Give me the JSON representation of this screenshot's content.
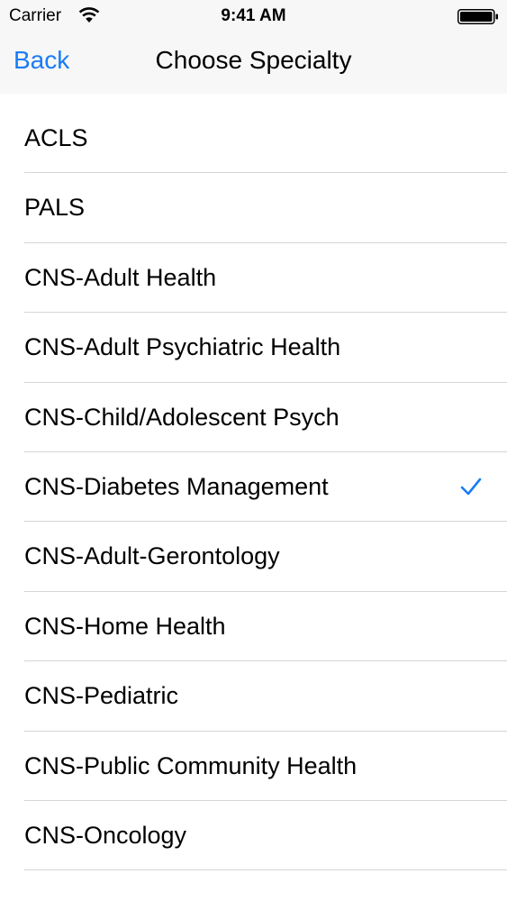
{
  "status_bar": {
    "carrier": "Carrier",
    "time": "9:41 AM",
    "icons": [
      "wifi-icon",
      "battery-icon"
    ]
  },
  "nav": {
    "back_label": "Back",
    "title": "Choose Specialty"
  },
  "accent_color": "#1a7cf5",
  "specialties": [
    {
      "label": "ACLS",
      "selected": false
    },
    {
      "label": "PALS",
      "selected": false
    },
    {
      "label": "CNS-Adult Health",
      "selected": false
    },
    {
      "label": "CNS-Adult Psychiatric Health",
      "selected": false
    },
    {
      "label": "CNS-Child/Adolescent Psych",
      "selected": false
    },
    {
      "label": "CNS-Diabetes Management",
      "selected": true
    },
    {
      "label": "CNS-Adult-Gerontology",
      "selected": false
    },
    {
      "label": "CNS-Home Health",
      "selected": false
    },
    {
      "label": "CNS-Pediatric",
      "selected": false
    },
    {
      "label": "CNS-Public Community Health",
      "selected": false
    },
    {
      "label": "CNS-Oncology",
      "selected": false
    }
  ]
}
